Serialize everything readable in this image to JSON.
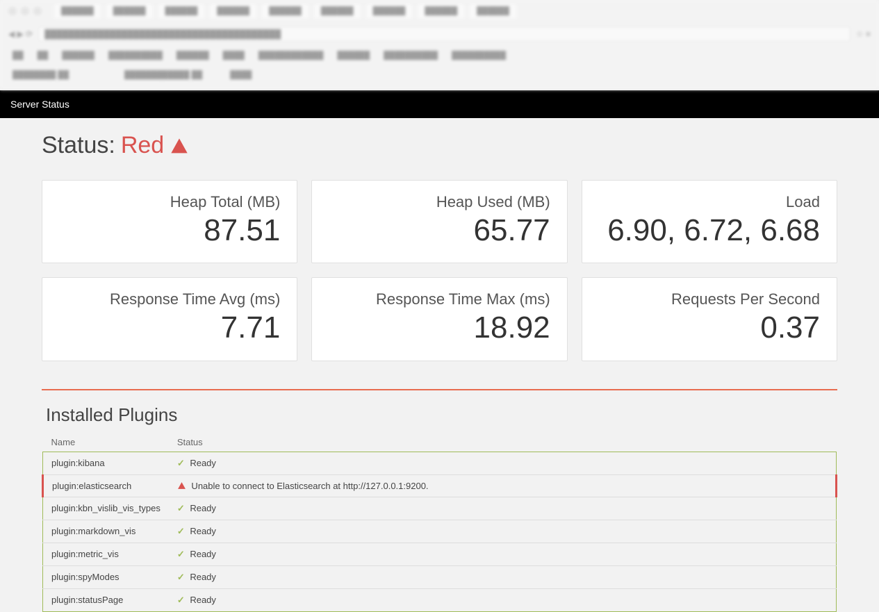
{
  "topbar": {
    "title": "Server Status"
  },
  "status": {
    "label": "Status:",
    "value": "Red"
  },
  "metrics": [
    {
      "label": "Heap Total (MB)",
      "value": "87.51"
    },
    {
      "label": "Heap Used (MB)",
      "value": "65.77"
    },
    {
      "label": "Load",
      "value": "6.90, 6.72, 6.68"
    },
    {
      "label": "Response Time Avg (ms)",
      "value": "7.71"
    },
    {
      "label": "Response Time Max (ms)",
      "value": "18.92"
    },
    {
      "label": "Requests Per Second",
      "value": "0.37"
    }
  ],
  "plugins": {
    "heading": "Installed Plugins",
    "columns": {
      "name": "Name",
      "status": "Status"
    },
    "rows": [
      {
        "name": "plugin:kibana",
        "status": "Ready",
        "ok": true
      },
      {
        "name": "plugin:elasticsearch",
        "status": "Unable to connect to Elasticsearch at http://127.0.0.1:9200.",
        "ok": false
      },
      {
        "name": "plugin:kbn_vislib_vis_types",
        "status": "Ready",
        "ok": true
      },
      {
        "name": "plugin:markdown_vis",
        "status": "Ready",
        "ok": true
      },
      {
        "name": "plugin:metric_vis",
        "status": "Ready",
        "ok": true
      },
      {
        "name": "plugin:spyModes",
        "status": "Ready",
        "ok": true
      },
      {
        "name": "plugin:statusPage",
        "status": "Ready",
        "ok": true
      }
    ]
  }
}
